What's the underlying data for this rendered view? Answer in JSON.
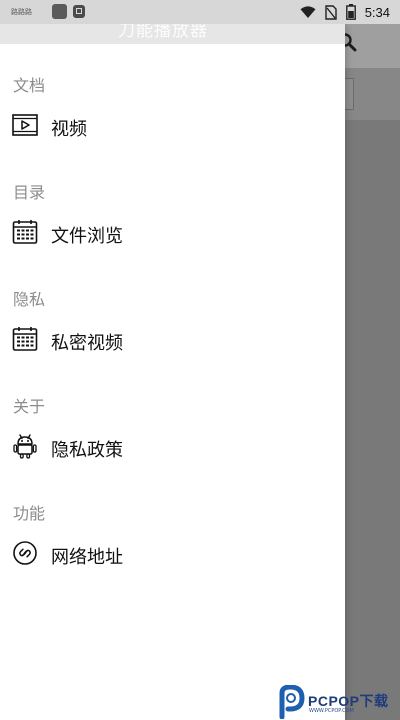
{
  "status_bar": {
    "left_text": "路路路",
    "time": "5:34",
    "icons": [
      "wifi-icon",
      "no-sim-icon",
      "battery-icon"
    ]
  },
  "app_title_ghost": "刀能播放器",
  "drawer": {
    "sections": [
      {
        "title": "文档",
        "item": {
          "label": "视频",
          "icon": "video-play-icon"
        }
      },
      {
        "title": "目录",
        "item": {
          "label": "文件浏览",
          "icon": "calendar-grid-icon"
        }
      },
      {
        "title": "隐私",
        "item": {
          "label": "私密视频",
          "icon": "calendar-grid-icon"
        }
      },
      {
        "title": "关于",
        "item": {
          "label": "隐私政策",
          "icon": "android-icon"
        }
      },
      {
        "title": "功能",
        "item": {
          "label": "网络地址",
          "icon": "link-icon"
        }
      }
    ]
  },
  "watermark": {
    "brand": "PCPOP下载",
    "sub": "WWW.PCPOP.COM"
  },
  "colors": {
    "drawer_bg": "#ffffff",
    "section_title": "#8c8c8c",
    "item_text": "#111111",
    "scrim": "#7d7d7d",
    "watermark_blue": "#1f3c7a"
  }
}
